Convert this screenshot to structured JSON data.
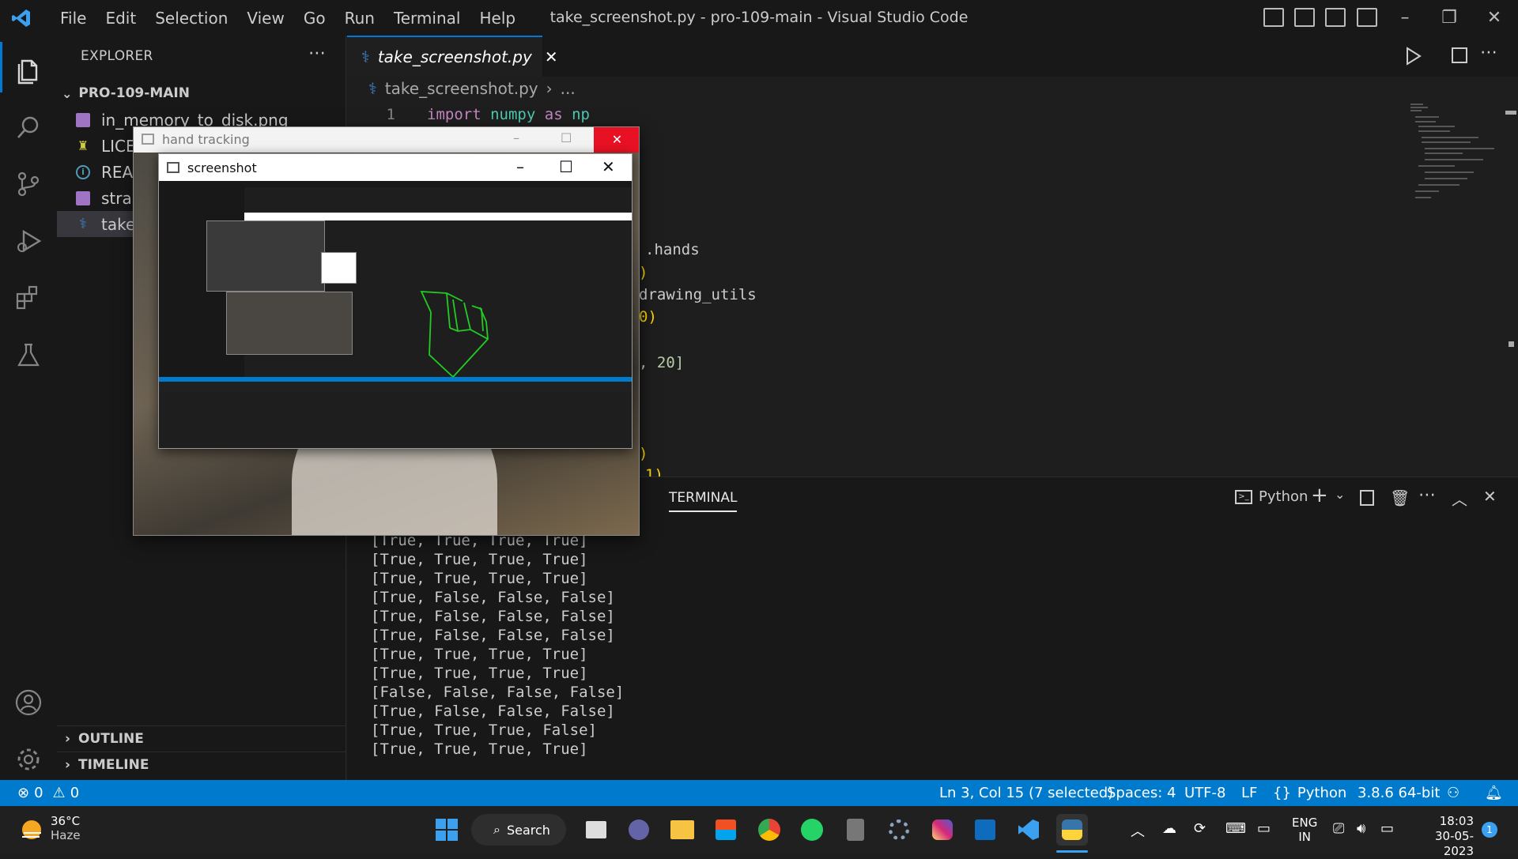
{
  "window": {
    "title": "take_screenshot.py - pro-109-main - Visual Studio Code",
    "menu": [
      "File",
      "Edit",
      "Selection",
      "View",
      "Go",
      "Run",
      "Terminal",
      "Help"
    ]
  },
  "sidebar": {
    "title": "EXPLORER",
    "folder": "PRO-109-MAIN",
    "files": [
      {
        "name": "in_memory_to_disk.png",
        "icon": "image-file-icon"
      },
      {
        "name": "LICENSE",
        "icon": "license-icon"
      },
      {
        "name": "README.md",
        "icon": "info-icon"
      },
      {
        "name": "straight_line.png",
        "icon": "image-file-icon"
      },
      {
        "name": "take_screenshot.py",
        "icon": "python-file-icon"
      }
    ],
    "outline": "OUTLINE",
    "timeline": "TIMELINE"
  },
  "editor": {
    "tab": "take_screenshot.py",
    "breadcrumb_file": "take_screenshot.py",
    "breadcrumb_rest": "...",
    "line1": {
      "num": "1",
      "kw1": "import",
      "mod": "numpy",
      "kw2": "as",
      "alias": "np"
    },
    "visible_fragments": {
      "hands": ".hands",
      "paren1": ")",
      "drawing": "drawing_utils",
      "zero_paren": "0)",
      "twenty": ", 20]",
      "paren2": ")",
      "one_paren": "1)"
    }
  },
  "panel": {
    "tab": "TERMINAL",
    "shell": "Python",
    "lines": [
      "[True, True, True, True]",
      "[True, True, True, True]",
      "[True, True, True, True]",
      "[True, False, False, False]",
      "[True, False, False, False]",
      "[True, False, False, False]",
      "[True, True, True, True]",
      "[True, True, True, True]",
      "[False, False, False, False]",
      "[True, False, False, False]",
      "[True, True, True, False]",
      "[True, True, True, True]"
    ]
  },
  "status": {
    "errors": "0",
    "warnings": "0",
    "position": "Ln 3, Col 15 (7 selected)",
    "spaces": "Spaces: 4",
    "encoding": "UTF-8",
    "eol": "LF",
    "language": "Python",
    "interpreter": "3.8.6 64-bit"
  },
  "hand_window": {
    "title": "hand tracking"
  },
  "screenshot_window": {
    "title": "screenshot"
  },
  "taskbar": {
    "weather_temp": "36°C",
    "weather_desc": "Haze",
    "search": "Search",
    "lang1": "ENG",
    "lang2": "IN",
    "time": "18:03",
    "date": "30-05-2023",
    "notif": "1"
  },
  "colors": {
    "accent": "#007acc",
    "keyword": "#c586c0",
    "module": "#4ec9b0",
    "hand_skeleton": "#22cc22"
  }
}
